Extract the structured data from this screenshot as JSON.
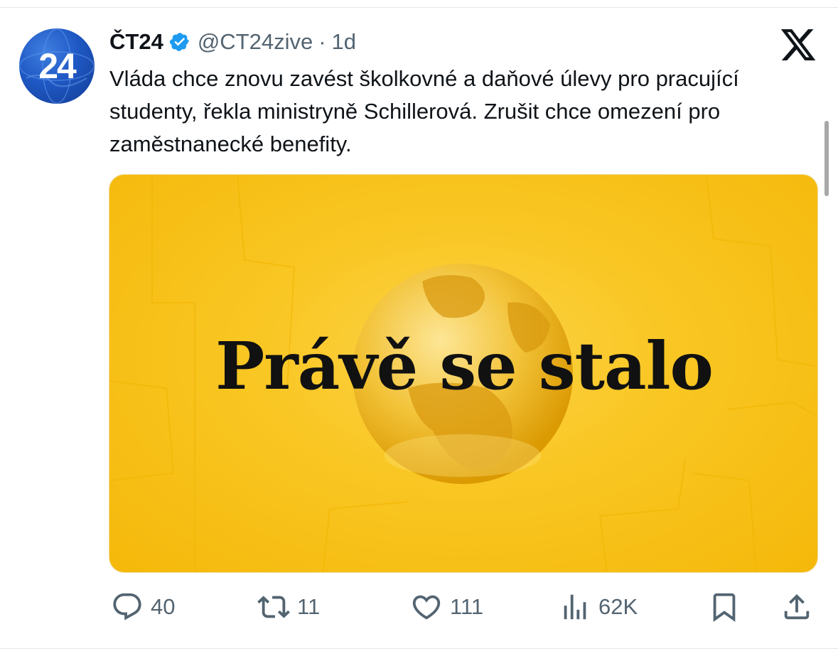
{
  "tweet": {
    "display_name": "ČT24",
    "handle": "@CT24zive",
    "separator": "·",
    "time": "1d",
    "avatar_text": "24",
    "text": "Vláda chce znovu zavést školkovné a daňové úlevy pro pracující studenty, řekla ministryně Schillerová. Zrušit chce omezení pro zaměstnanecké benefity.",
    "media": {
      "headline": "Právě se stalo",
      "accent_color": "#f9c724"
    }
  },
  "actions": {
    "replies": "40",
    "retweets": "11",
    "likes": "111",
    "views": "62K"
  },
  "icons": {
    "verified": "verified-badge-icon",
    "platform": "x-logo-icon",
    "reply": "reply-icon",
    "retweet": "retweet-icon",
    "like": "heart-icon",
    "views": "views-icon",
    "bookmark": "bookmark-icon",
    "share": "share-icon"
  },
  "colors": {
    "verified": "#1d9bf0",
    "muted": "#536471",
    "text": "#0f1419"
  }
}
